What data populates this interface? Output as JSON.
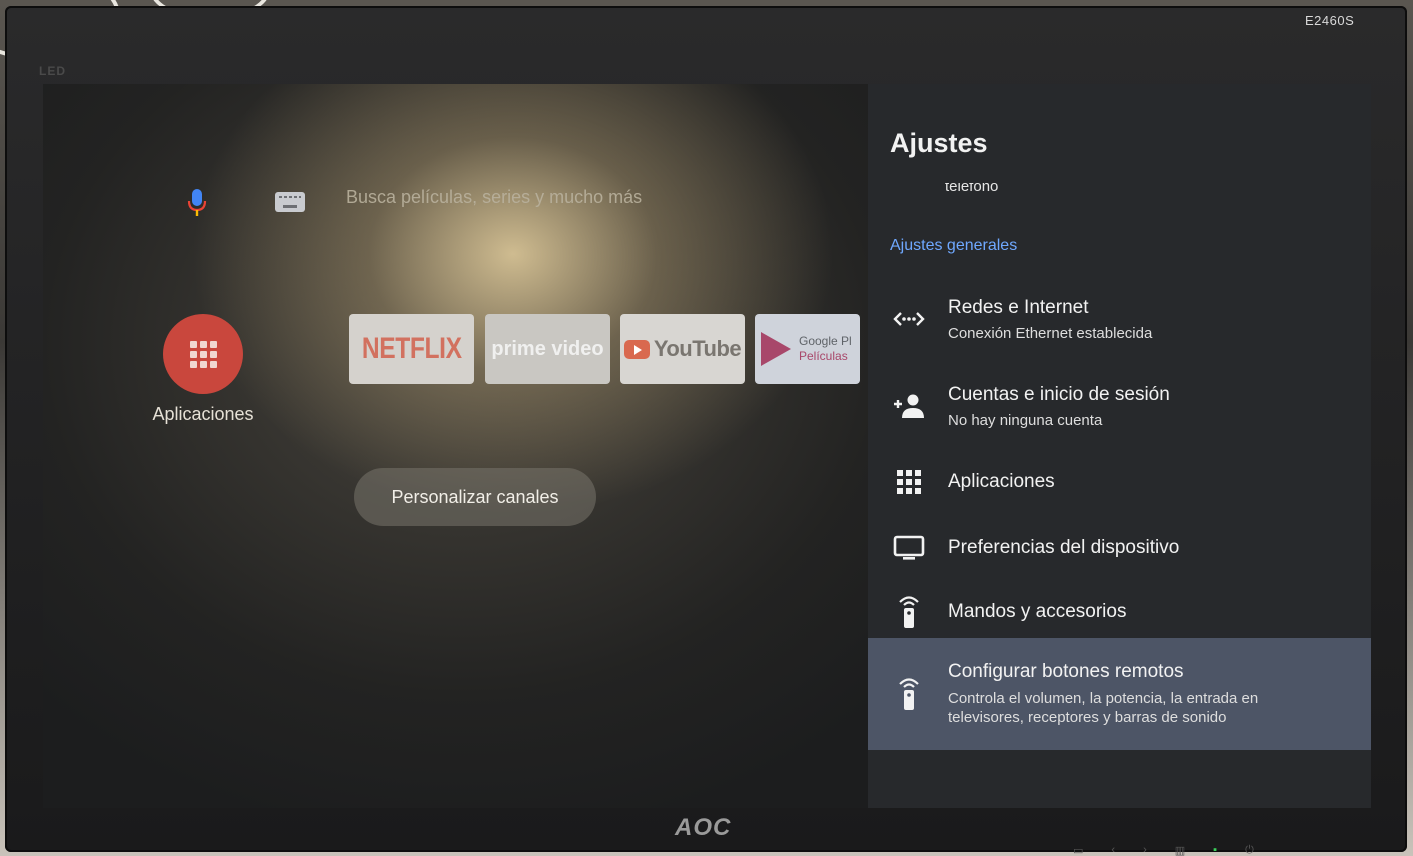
{
  "monitor": {
    "model": "E2460S",
    "brand": "AOC",
    "led_label": "LED"
  },
  "home": {
    "search_placeholder": "Busca películas, series y mucho más",
    "apps_label": "Aplicaciones",
    "tiles": {
      "netflix": "NETFLIX",
      "prime": "prime video",
      "youtube": "YouTube",
      "google_play_line1": "Google Pl",
      "google_play_line2": "Películas"
    },
    "customize_button": "Personalizar canales"
  },
  "settings": {
    "title": "Ajustes",
    "partial_item": "teléfono",
    "section_header": "Ajustes generales",
    "items": [
      {
        "title": "Redes e Internet",
        "subtitle": "Conexión Ethernet establecida",
        "icon": "network-icon"
      },
      {
        "title": "Cuentas e inicio de sesión",
        "subtitle": "No hay ninguna cuenta",
        "icon": "add-account-icon"
      },
      {
        "title": "Aplicaciones",
        "subtitle": "",
        "icon": "apps-grid-icon"
      },
      {
        "title": "Preferencias del dispositivo",
        "subtitle": "",
        "icon": "tv-icon"
      },
      {
        "title": "Mandos y accesorios",
        "subtitle": "",
        "icon": "remote-icon"
      },
      {
        "title": "Configurar botones remotos",
        "subtitle": "Controla el volumen, la potencia, la entrada en televisores, receptores y barras de sonido",
        "icon": "remote-icon"
      }
    ],
    "selected_index": 5
  },
  "colors": {
    "panel_bg": "#27292c",
    "selected_bg": "#4d5566",
    "section_header": "#6fa8ff",
    "apps_circle": "#c9473d"
  }
}
